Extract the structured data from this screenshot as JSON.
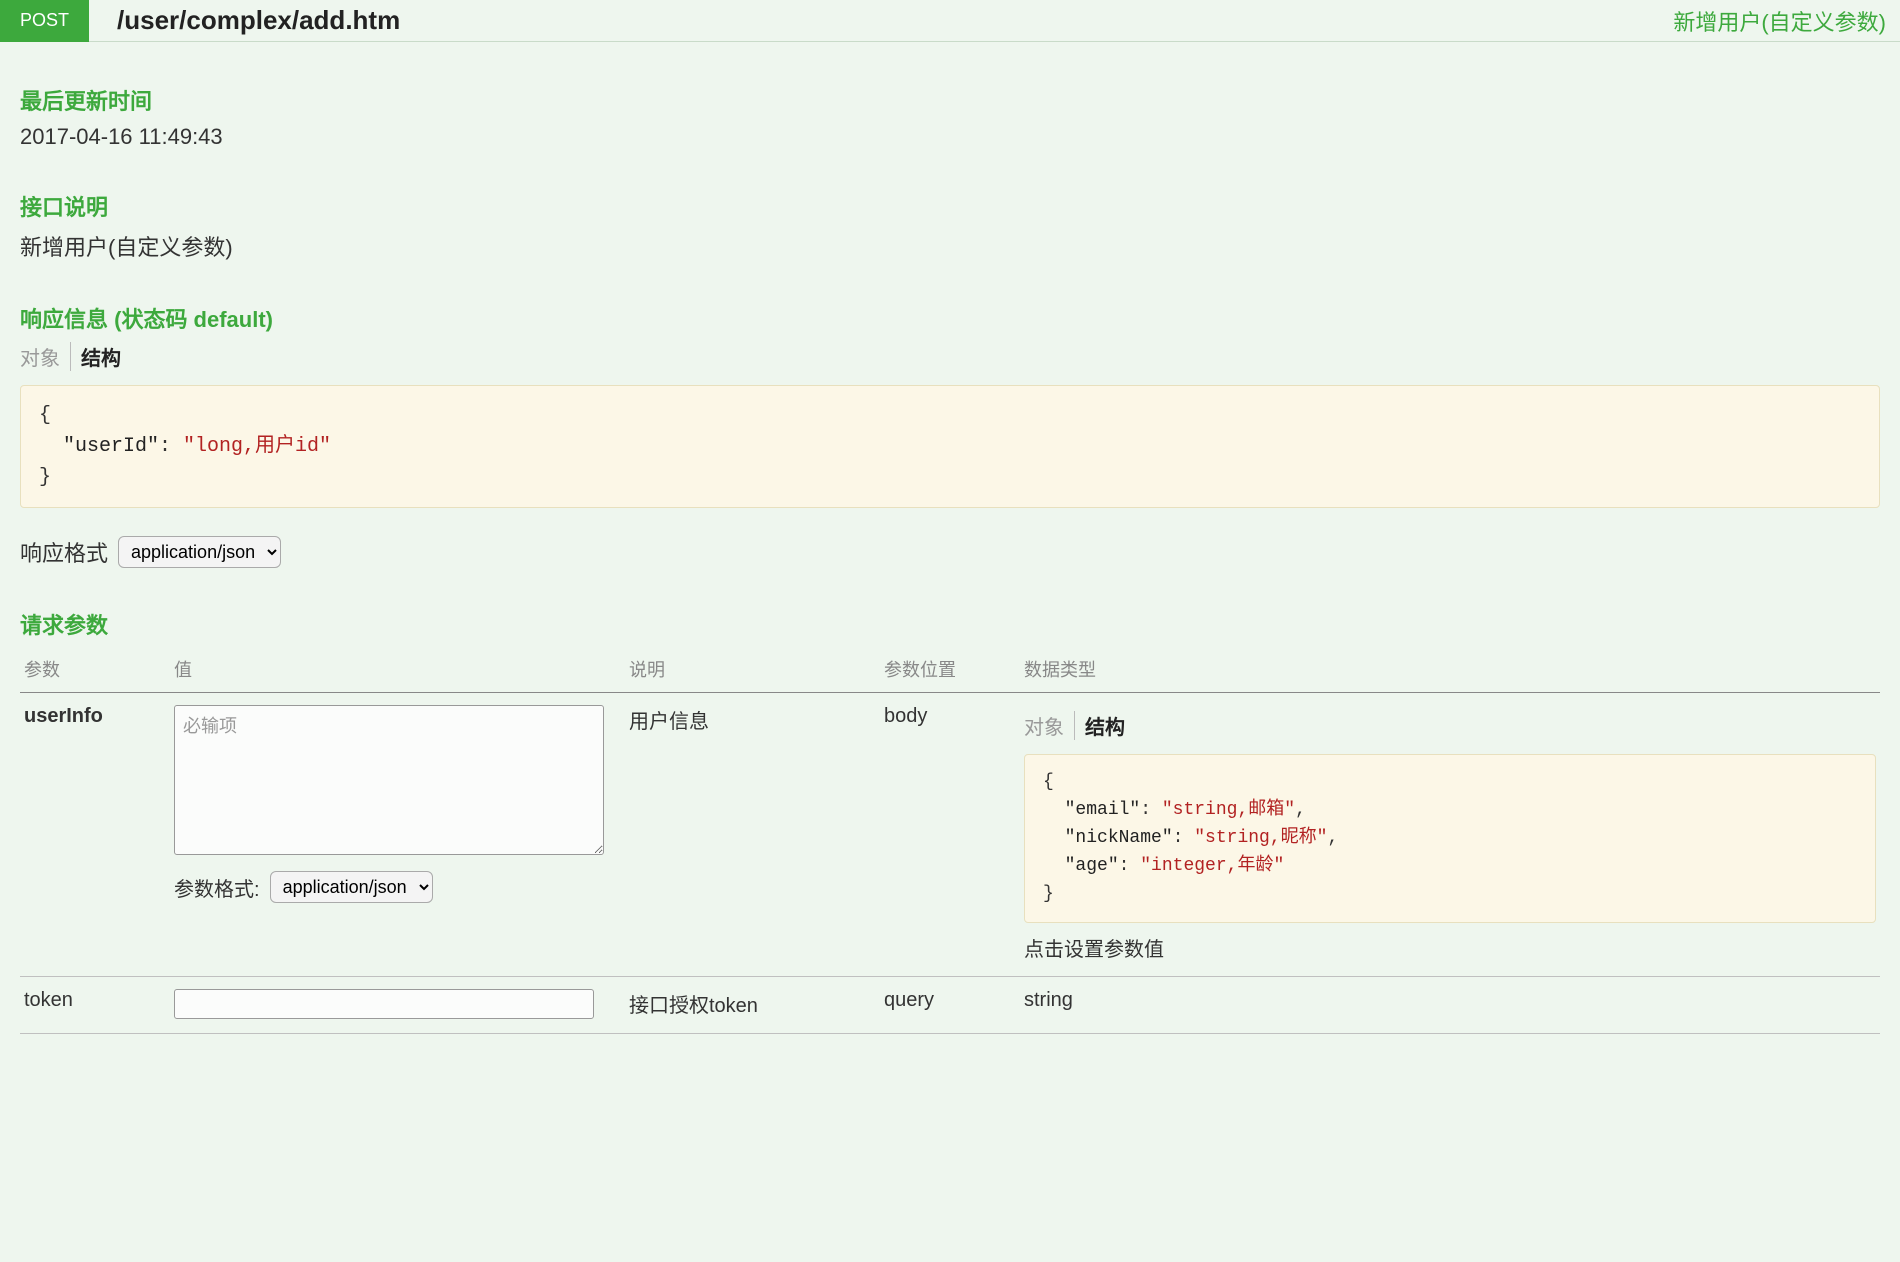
{
  "header": {
    "method": "POST",
    "path": "/user/complex/add.htm",
    "title": "新增用户(自定义参数)"
  },
  "updated": {
    "label": "最后更新时间",
    "value": "2017-04-16 11:49:43"
  },
  "desc": {
    "label": "接口说明",
    "value": "新增用户(自定义参数)"
  },
  "response": {
    "label": "响应信息 (状态码 default)",
    "tab_object": "对象",
    "tab_struct": "结构",
    "json_lines": [
      {
        "t": "plain",
        "s": "{"
      },
      {
        "t": "kv",
        "indent": 1,
        "k": "\"userId\"",
        "v": "\"long,用户id\""
      },
      {
        "t": "plain",
        "s": "}"
      }
    ],
    "format_label": "响应格式",
    "format_value": "application/json"
  },
  "request": {
    "label": "请求参数",
    "columns": {
      "param": "参数",
      "value": "值",
      "desc": "说明",
      "pos": "参数位置",
      "type": "数据类型"
    },
    "rows": [
      {
        "param": "userInfo",
        "bold": true,
        "value_kind": "textarea",
        "placeholder": "必输项",
        "value_format_label": "参数格式:",
        "value_format": "application/json",
        "desc": "用户信息",
        "pos": "body",
        "type_kind": "struct",
        "tab_object": "对象",
        "tab_struct": "结构",
        "json_lines": [
          {
            "t": "plain",
            "s": "{"
          },
          {
            "t": "kv",
            "indent": 1,
            "k": "\"email\"",
            "v": "\"string,邮箱\"",
            "comma": true
          },
          {
            "t": "kv",
            "indent": 1,
            "k": "\"nickName\"",
            "v": "\"string,昵称\"",
            "comma": true
          },
          {
            "t": "kv",
            "indent": 1,
            "k": "\"age\"",
            "v": "\"integer,年龄\""
          },
          {
            "t": "plain",
            "s": "}"
          }
        ],
        "type_hint": "点击设置参数值"
      },
      {
        "param": "token",
        "bold": false,
        "value_kind": "input",
        "desc": "接口授权token",
        "pos": "query",
        "type_kind": "plain",
        "type_text": "string"
      }
    ]
  }
}
